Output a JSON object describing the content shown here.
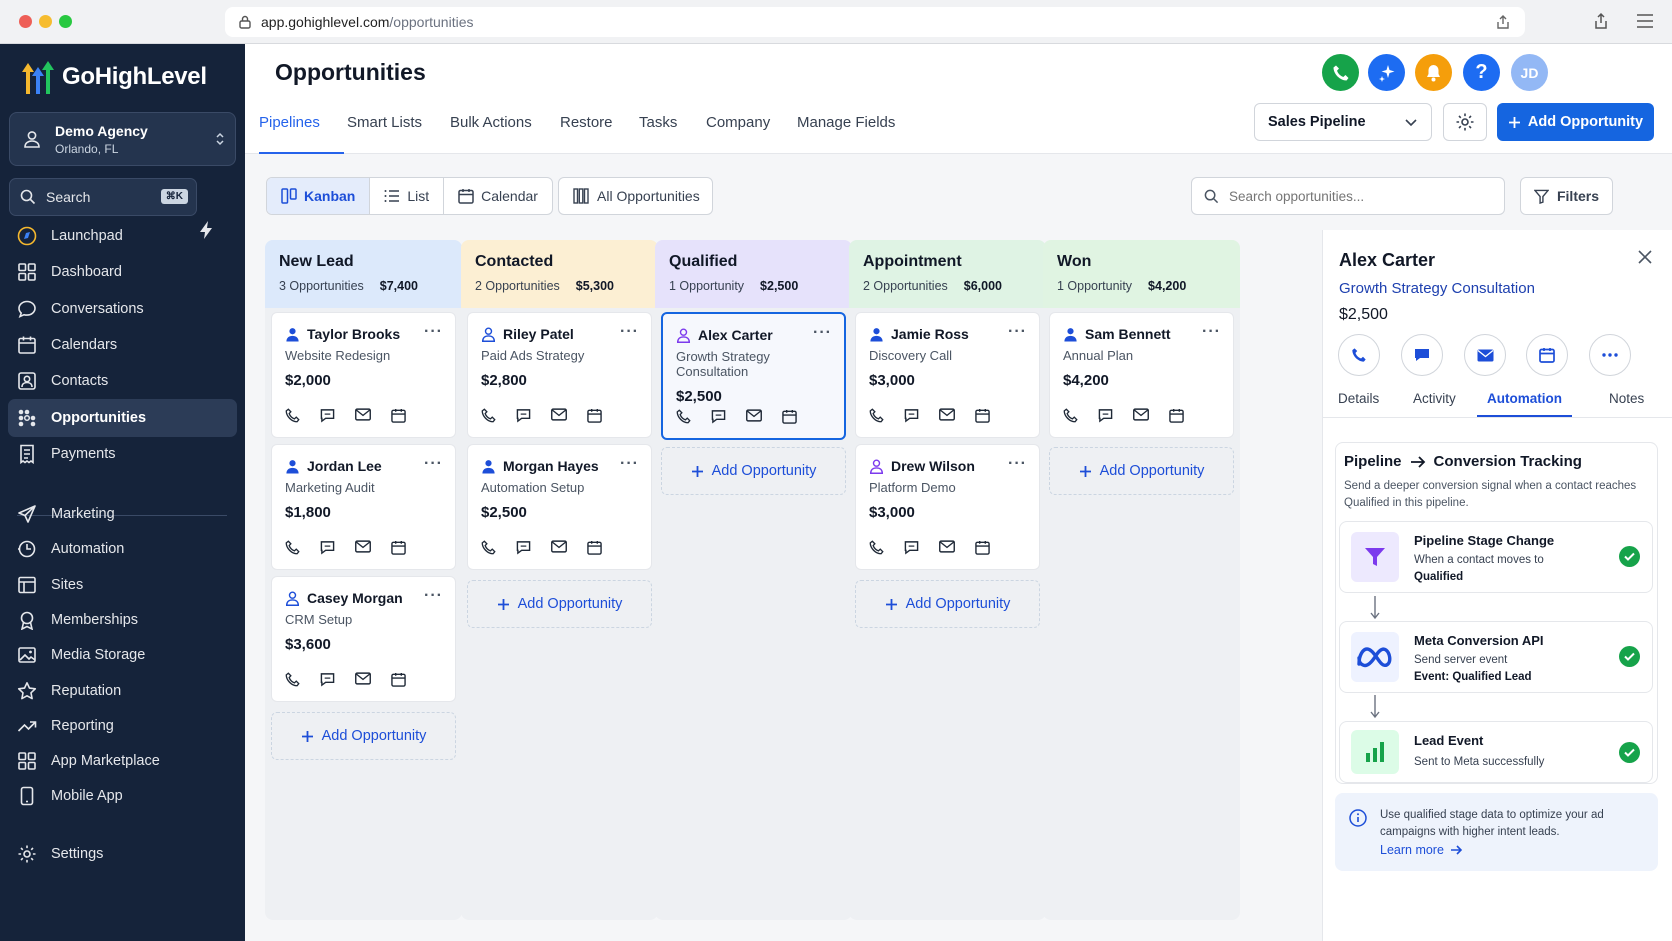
{
  "browser": {
    "url_host": "app.gohighlevel.com",
    "url_path": "/opportunities"
  },
  "brand": {
    "name": "GoHighLevel"
  },
  "agency": {
    "name": "Demo Agency",
    "location": "Orlando, FL"
  },
  "sidebar": {
    "search_label": "Search",
    "search_shortcut": "⌘K",
    "items": [
      {
        "label": "Launchpad",
        "icon": "launchpad-icon"
      },
      {
        "label": "Dashboard",
        "icon": "dashboard-icon"
      },
      {
        "label": "Conversations",
        "icon": "chat-icon"
      },
      {
        "label": "Calendars",
        "icon": "calendar-icon"
      },
      {
        "label": "Contacts",
        "icon": "contacts-icon"
      },
      {
        "label": "Opportunities",
        "icon": "opportunities-icon",
        "active": true
      },
      {
        "label": "Payments",
        "icon": "payments-icon"
      }
    ],
    "items2": [
      {
        "label": "Marketing",
        "icon": "send-icon"
      },
      {
        "label": "Automation",
        "icon": "automation-icon"
      },
      {
        "label": "Sites",
        "icon": "sites-icon"
      },
      {
        "label": "Memberships",
        "icon": "memberships-icon"
      },
      {
        "label": "Media Storage",
        "icon": "image-icon"
      },
      {
        "label": "Reputation",
        "icon": "star-icon"
      },
      {
        "label": "Reporting",
        "icon": "trend-icon"
      },
      {
        "label": "App Marketplace",
        "icon": "apps-icon"
      },
      {
        "label": "Mobile App",
        "icon": "mobile-icon"
      }
    ],
    "settings_label": "Settings"
  },
  "header": {
    "title": "Opportunities",
    "avatar_initials": "JD",
    "help_glyph": "?",
    "tabs": [
      "Pipelines",
      "Smart Lists",
      "Bulk Actions",
      "Restore",
      "Tasks",
      "Company",
      "Manage Fields"
    ],
    "pipeline_select": "Sales Pipeline",
    "add_button": "Add Opportunity"
  },
  "toolbar": {
    "views": [
      "Kanban",
      "List",
      "Calendar"
    ],
    "all_opportunities": "All Opportunities",
    "search_placeholder": "Search opportunities...",
    "filters": "Filters"
  },
  "colors": {
    "accent": "#1565e0",
    "sidebar": "#15233a",
    "new_lead": "#dce9fb",
    "contacted": "#fcefd3",
    "qualified": "#e6e2fb",
    "appointment": "#dff3e4",
    "won": "#e0f4e2"
  },
  "add_opportunity_label": "Add Opportunity",
  "columns": [
    {
      "title": "New Lead",
      "count": "3 Opportunities",
      "amount": "$7,400",
      "cards": [
        {
          "name": "Taylor Brooks",
          "desc": "Website Redesign",
          "amount": "$2,000"
        },
        {
          "name": "Jordan Lee",
          "desc": "Marketing Audit",
          "amount": "$1,800"
        },
        {
          "name": "Casey Morgan",
          "desc": "CRM Setup",
          "amount": "$3,600"
        }
      ]
    },
    {
      "title": "Contacted",
      "count": "2 Opportunities",
      "amount": "$5,300",
      "cards": [
        {
          "name": "Riley Patel",
          "desc": "Paid Ads Strategy",
          "amount": "$2,800"
        },
        {
          "name": "Morgan Hayes",
          "desc": "Automation Setup",
          "amount": "$2,500"
        }
      ]
    },
    {
      "title": "Qualified",
      "count": "1 Opportunity",
      "amount": "$2,500",
      "cards": [
        {
          "name": "Alex Carter",
          "desc": "Growth Strategy Consultation",
          "amount": "$2,500",
          "selected": true
        }
      ]
    },
    {
      "title": "Appointment",
      "count": "2 Opportunities",
      "amount": "$6,000",
      "cards": [
        {
          "name": "Jamie Ross",
          "desc": "Discovery Call",
          "amount": "$3,000"
        },
        {
          "name": "Drew Wilson",
          "desc": "Platform Demo",
          "amount": "$3,000"
        }
      ]
    },
    {
      "title": "Won",
      "count": "1 Opportunity",
      "amount": "$4,200",
      "cards": [
        {
          "name": "Sam Bennett",
          "desc": "Annual Plan",
          "amount": "$4,200"
        }
      ]
    }
  ],
  "panel": {
    "name": "Alex Carter",
    "subtitle": "Growth Strategy Consultation",
    "amount": "$2,500",
    "tabs": [
      "Details",
      "Activity",
      "Automation",
      "Notes"
    ],
    "active_tab": "Automation",
    "flow_title_a": "Pipeline",
    "flow_title_b": "Conversion Tracking",
    "flow_desc": "Send a deeper conversion signal when a contact reaches Qualified in this pipeline.",
    "steps": [
      {
        "title": "Pipeline Stage Change",
        "line1": "When a contact moves to",
        "line2": "Qualified"
      },
      {
        "title": "Meta Conversion API",
        "line1": "Send server event",
        "line2": "Event: Qualified Lead"
      },
      {
        "title": "Lead Event",
        "line1": "Sent to Meta successfully",
        "line2": ""
      }
    ],
    "tip_text": "Use qualified stage data to optimize your ad campaigns with higher intent leads.",
    "tip_link": "Learn more"
  }
}
